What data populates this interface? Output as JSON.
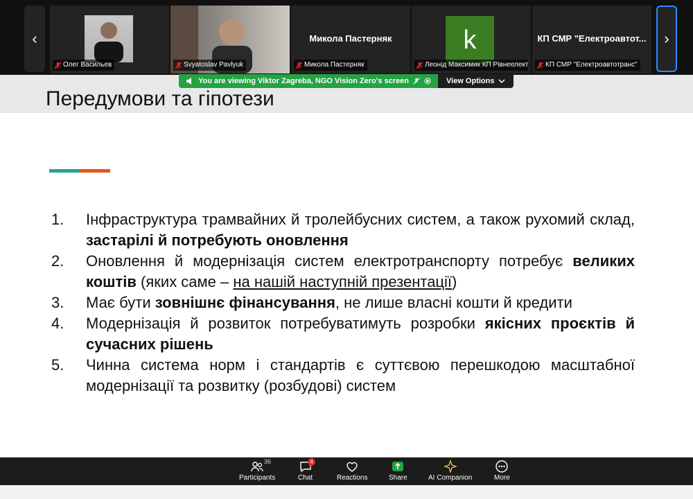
{
  "participants": [
    {
      "name": "Олег Васильев",
      "display": "video"
    },
    {
      "name": "Svyatoslav Pavlyuk",
      "display": "video"
    },
    {
      "name": "Микола Пастерняк",
      "display": "name",
      "center_name": "Микола Пастерняк"
    },
    {
      "name": "Леонід Максимик КП Рівнеелектро...",
      "display": "avatar",
      "avatar_letter": "k",
      "avatar_color": "#3b7d23"
    },
    {
      "name": "КП СМР \"Електроавтотранс\"",
      "display": "name",
      "center_name": "КП СМР \"Електроавтот..."
    }
  ],
  "nav": {
    "prev": "‹",
    "next": "›"
  },
  "viewing_bar": {
    "message": "You are viewing  Viktor Zagreba, NGO Vision Zero's screen",
    "options": "View Options"
  },
  "slide": {
    "title": "Передумови та гіпотези",
    "items": [
      {
        "num": "1.",
        "parts": [
          {
            "t": "Інфраструктура трамвайних й тролейбусних систем, а також рухомий склад, "
          },
          {
            "t": "застарілі й потребують оновлення",
            "b": true
          }
        ]
      },
      {
        "num": "2.",
        "parts": [
          {
            "t": "Оновлення й модернізація систем електротранспорту потребує "
          },
          {
            "t": "великих коштів",
            "b": true
          },
          {
            "t": " (яких саме – "
          },
          {
            "t": "на нашій наступній презентації",
            "u": true
          },
          {
            "t": ")"
          }
        ]
      },
      {
        "num": "3.",
        "parts": [
          {
            "t": "Має бути "
          },
          {
            "t": "зовнішнє фінансування",
            "b": true
          },
          {
            "t": ", не лише власні кошти й кредити"
          }
        ]
      },
      {
        "num": "4.",
        "parts": [
          {
            "t": "Модернізація й розвиток потребуватимуть розробки "
          },
          {
            "t": "якісних проєктів й сучасних рішень",
            "b": true
          }
        ]
      },
      {
        "num": "5.",
        "parts": [
          {
            "t": "Чинна система норм і стандартів є суттєвою перешкодою масштабної модернізації та розвитку (розбудові) систем"
          }
        ]
      }
    ]
  },
  "toolbar": {
    "participants_label": "Participants",
    "participants_count": "36",
    "chat_label": "Chat",
    "chat_badge": "4",
    "reactions_label": "Reactions",
    "share_label": "Share",
    "ai_label": "AI Companion",
    "more_label": "More"
  },
  "colors": {
    "share_green": "#25a244",
    "accent_teal": "#2aa198",
    "accent_orange": "#e05a1c"
  }
}
